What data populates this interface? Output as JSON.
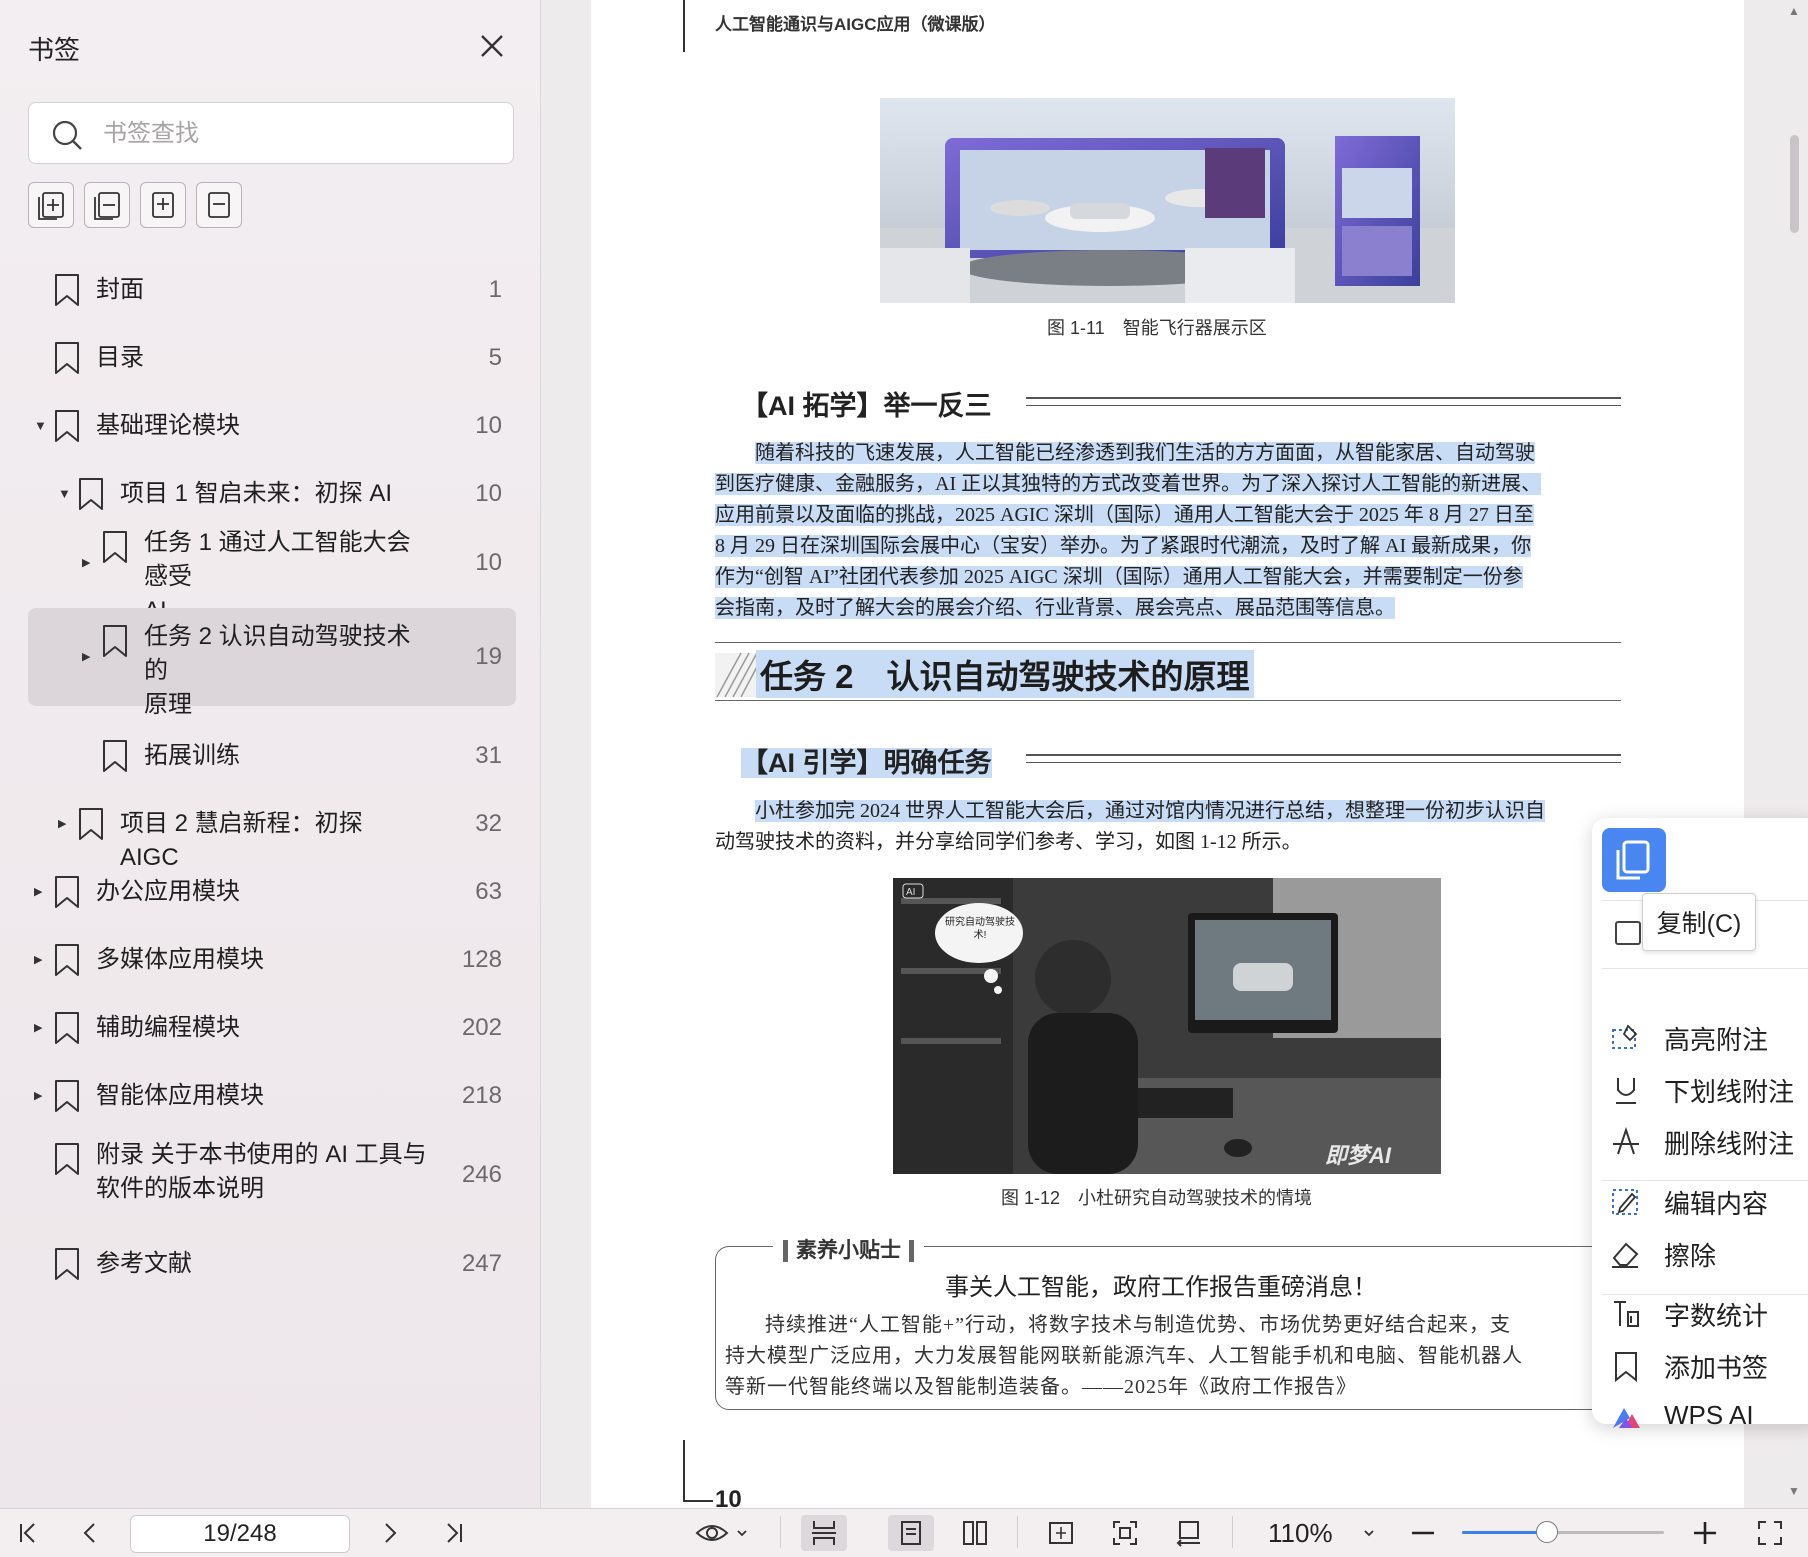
{
  "sidebar": {
    "title": "书签",
    "search_placeholder": "书签查找",
    "items": [
      {
        "label": "封面",
        "page": "1"
      },
      {
        "label": "目录",
        "page": "5"
      },
      {
        "label": "基础理论模块",
        "page": "10"
      },
      {
        "label": "项目 1 智启未来：初探 AI",
        "page": "10"
      },
      {
        "label": "任务 1 通过人工智能大会感受",
        "label2": "AI",
        "page": "10"
      },
      {
        "label": "任务 2 认识自动驾驶技术的",
        "label2": "原理",
        "page": "19"
      },
      {
        "label": "拓展训练",
        "page": "31"
      },
      {
        "label": "项目 2 慧启新程：初探 AIGC",
        "page": "32"
      },
      {
        "label": "办公应用模块",
        "page": "63"
      },
      {
        "label": "多媒体应用模块",
        "page": "128"
      },
      {
        "label": "辅助编程模块",
        "page": "202"
      },
      {
        "label": "智能体应用模块",
        "page": "218"
      },
      {
        "label": "附录 关于本书使用的 AI 工具与",
        "label2": "软件的版本说明",
        "page": "246"
      },
      {
        "label": "参考文献",
        "page": "247"
      }
    ]
  },
  "document": {
    "running_head": "人工智能通识与AIGC应用（微课版）",
    "fig1_caption": "图 1-11　智能飞行器展示区",
    "section1_title": "【AI 拓学】举一反三",
    "section1_lines": [
      "随着科技的飞速发展，人工智能已经渗透到我们生活的方方面面，从智能家居、自动驾驶",
      "到医疗健康、金融服务，AI 正以其独特的方式改变着世界。为了深入探讨人工智能的新进展、",
      "应用前景以及面临的挑战，2025 AGIC 深圳（国际）通用人工智能大会于 2025 年 8 月 27 日至",
      "8 月 29 日在深圳国际会展中心（宝安）举办。为了紧跟时代潮流，及时了解 AI 最新成果，你",
      "作为“创智 AI”社团代表参加 2025 AIGC 深圳（国际）通用人工智能大会，并需要制定一份参",
      "会指南，及时了解大会的展会介绍、行业背景、展会亮点、展品范围等信息。"
    ],
    "task_title": "任务 2　认识自动驾驶技术的原理",
    "section2_title": "【AI 引学】明确任务",
    "section2_lines": [
      "小杜参加完 2024 世界人工智能大会后，通过对馆内情况进行总结，想整理一份初步认识自",
      "动驾驶技术的资料，并分享给同学们参考、学习，如图 1-12 所示。"
    ],
    "fig2_bubble": "研究自动驾驶技术!",
    "fig2_watermark": "即梦AI",
    "fig2_badge": "AI",
    "fig2_caption": "图 1-12　小杜研究自动驾驶技术的情境",
    "tip_label": "素养小贴士",
    "tip_heading": "事关人工智能，政府工作报告重磅消息！",
    "tip_lines": [
      "持续推进“人工智能+”行动，将数字技术与制造优势、市场优势更好结合起来，支",
      "持大模型广泛应用，大力发展智能网联新能源汽车、人工智能手机和电脑、智能机器人",
      "等新一代智能终端以及智能制造装备。——2025年《政府工作报告》"
    ],
    "page_number": "10"
  },
  "context_menu": {
    "tooltip": "复制(C)",
    "items": [
      {
        "label": "高亮附注",
        "icon": "highlight-icon"
      },
      {
        "label": "下划线附注",
        "icon": "underline-icon"
      },
      {
        "label": "删除线附注",
        "icon": "strikethrough-icon"
      },
      {
        "label": "编辑内容",
        "icon": "edit-icon"
      },
      {
        "label": "擦除",
        "icon": "eraser-icon"
      },
      {
        "label": "字数统计",
        "icon": "word-count-icon"
      },
      {
        "label": "添加书签",
        "icon": "bookmark-icon"
      },
      {
        "label": "WPS AI",
        "icon": "wps-ai-icon"
      }
    ]
  },
  "toolbar": {
    "page_indicator": "19/248",
    "zoom": "110%",
    "zoom_fraction": 0.42
  },
  "colors": {
    "selection": "#c9dcf6",
    "accent": "#3d7ff0",
    "copy_button": "#4a86f2"
  }
}
